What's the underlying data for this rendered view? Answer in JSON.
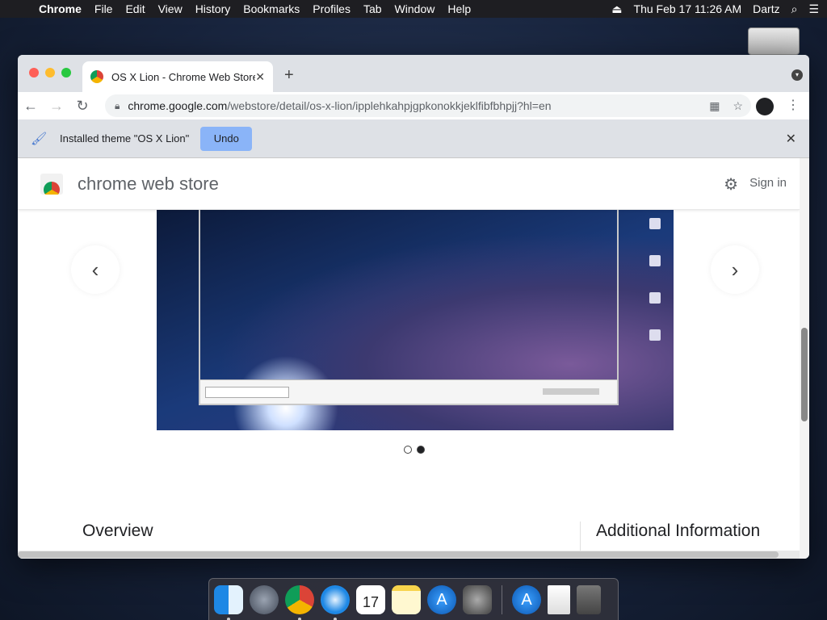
{
  "menubar": {
    "app": "Chrome",
    "items": [
      "File",
      "Edit",
      "View",
      "History",
      "Bookmarks",
      "Profiles",
      "Tab",
      "Window",
      "Help"
    ],
    "clock": "Thu Feb 17  11:26 AM",
    "user": "Dartz"
  },
  "tab": {
    "title": "OS X Lion - Chrome Web Store"
  },
  "omnibox": {
    "host": "chrome.google.com",
    "path": "/webstore/detail/os-x-lion/ipplehkahpjgpkonokkjeklfibfbhpjj?hl=en"
  },
  "infobar": {
    "message": "Installed theme \"OS X Lion\"",
    "undo_label": "Undo"
  },
  "store": {
    "name": "chrome web store",
    "signin": "Sign in"
  },
  "gallery": {
    "total_slides": 2,
    "active_slide": 2
  },
  "sections": {
    "overview": "Overview",
    "additional_info": "Additional Information"
  },
  "dock": {
    "calendar_day": "17"
  },
  "colors": {
    "undo_button": "#8ab4f8",
    "menubar": "#1e1e22",
    "tabstrip": "#dee1e6"
  }
}
